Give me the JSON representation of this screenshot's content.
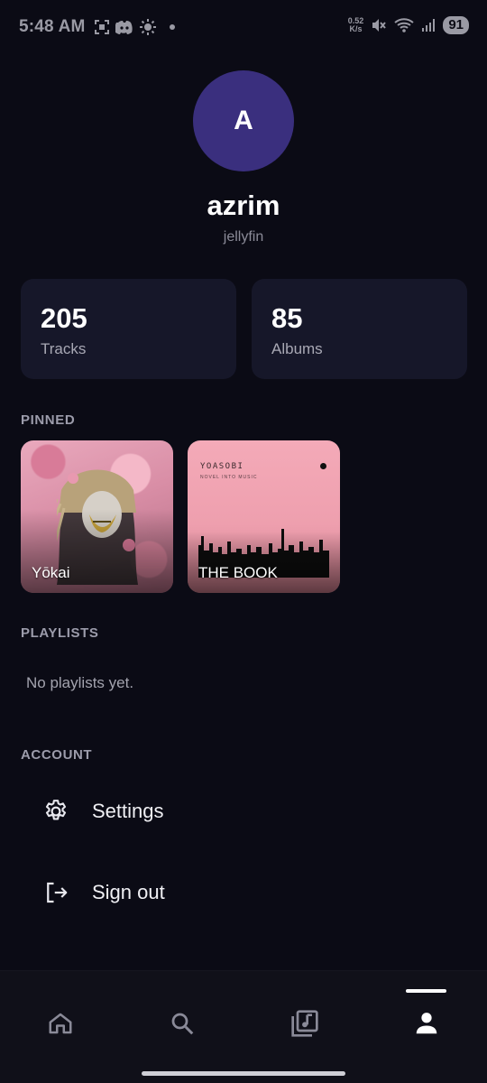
{
  "status_bar": {
    "time": "5:48 AM",
    "net_speed_value": "0.52",
    "net_speed_unit": "K/s",
    "battery": "91"
  },
  "profile": {
    "avatar_letter": "A",
    "username": "azrim",
    "server": "jellyfin"
  },
  "stats": {
    "tracks_value": "205",
    "tracks_label": "Tracks",
    "albums_value": "85",
    "albums_label": "Albums"
  },
  "pinned": {
    "title": "PINNED",
    "items": [
      {
        "label": "Yōkai"
      },
      {
        "label": "THE BOOK",
        "brand": "YOASOBI",
        "sub": "NOVEL INTO MUSIC"
      }
    ]
  },
  "playlists": {
    "title": "PLAYLISTS",
    "empty_text": "No playlists yet."
  },
  "account": {
    "title": "ACCOUNT",
    "settings_label": "Settings",
    "signout_label": "Sign out"
  },
  "nav": {
    "active": "profile",
    "items": [
      "home-icon",
      "search-icon",
      "library-icon",
      "profile-icon"
    ]
  },
  "colors": {
    "background": "#0b0b15",
    "card": "#161729",
    "avatar": "#3a2f7e",
    "muted_text": "#9c9cab"
  }
}
